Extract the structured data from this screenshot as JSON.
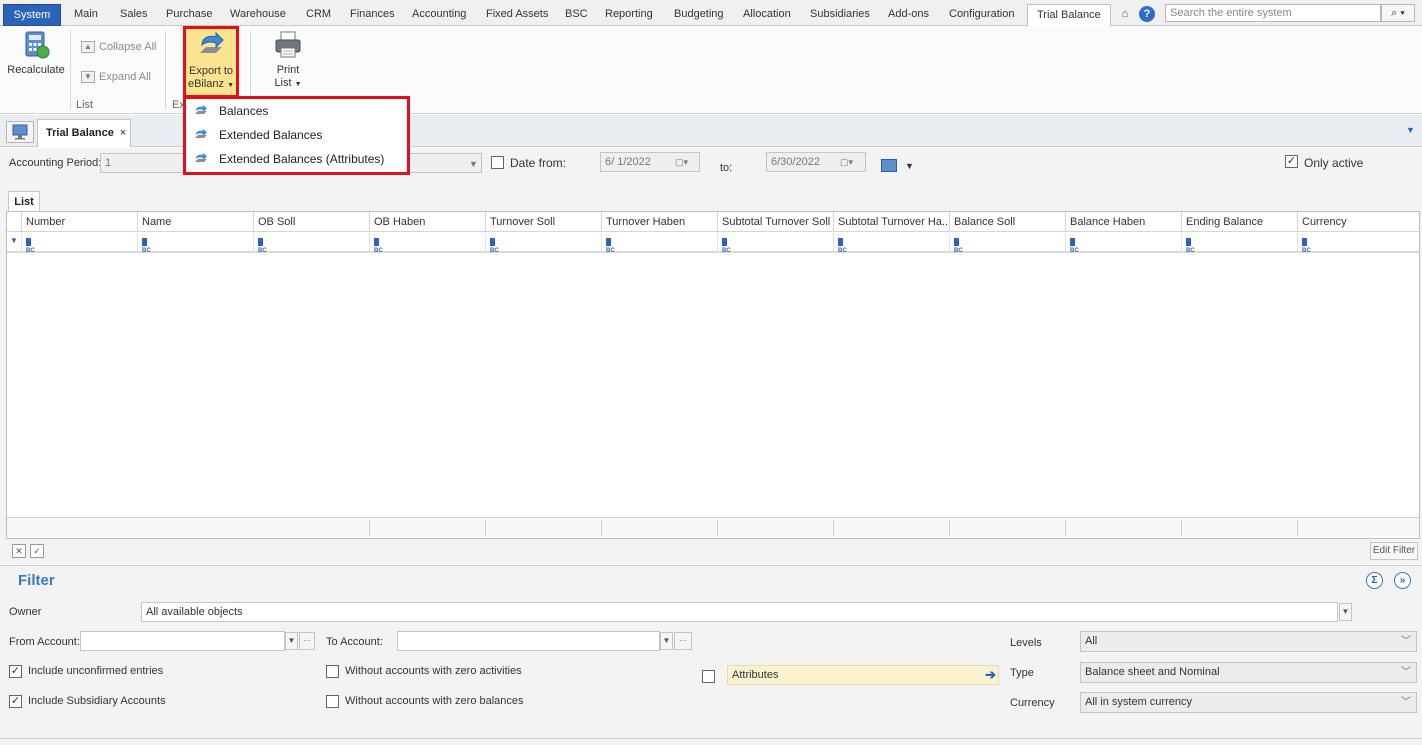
{
  "menu": {
    "tabs": [
      "System",
      "Main",
      "Sales",
      "Purchase",
      "Warehouse",
      "CRM",
      "Finances",
      "Accounting",
      "Fixed Assets",
      "BSC",
      "Reporting",
      "Budgeting",
      "Allocation",
      "Subsidiaries",
      "Add-ons",
      "Configuration",
      "Trial Balance"
    ],
    "active_tab": "Trial Balance",
    "search_placeholder": "Search the entire system"
  },
  "ribbon": {
    "recalculate": "Recalculate",
    "collapse_all": "Collapse All",
    "expand_all": "Expand All",
    "group_list": "List",
    "group_export_partial": "Ex",
    "export_line1": "Export to",
    "export_line2": "eBilanz",
    "print_line1": "Print",
    "print_line2": "List",
    "dropdown_items": [
      "Balances",
      "Extended Balances",
      "Extended Balances (Attributes)"
    ]
  },
  "doc_tab": {
    "title": "Trial Balance",
    "close": "×"
  },
  "params": {
    "accounting_period_label": "Accounting Period:",
    "accounting_period_value": "1",
    "date_from_label": "Date from:",
    "date_from_value": "6/ 1/2022",
    "to_label": "to:",
    "date_to_value": "6/30/2022",
    "only_active_label": "Only active",
    "only_active_checked": true,
    "date_from_checked": false
  },
  "list": {
    "tab": "List",
    "columns": [
      "Number",
      "Name",
      "OB Soll",
      "OB Haben",
      "Turnover Soll",
      "Turnover Haben",
      "Subtotal Turnover Soll",
      "Subtotal Turnover Ha...",
      "Balance Soll",
      "Balance Haben",
      "Ending Balance",
      "Currency"
    ],
    "filter_cell_text": "BC",
    "edit_filter": "Edit Filter"
  },
  "filter": {
    "title": "Filter",
    "owner_label": "Owner",
    "owner_value": "All available objects",
    "from_account_label": "From Account:",
    "to_account_label": "To Account:",
    "include_unconfirmed": "Include unconfirmed entries",
    "include_subsidiary": "Include Subsidiary Accounts",
    "without_zero_activities": "Without accounts with zero activities",
    "without_zero_balances": "Without accounts with zero balances",
    "attributes": "Attributes",
    "levels_label": "Levels",
    "levels_value": "All",
    "type_label": "Type",
    "type_value": "Balance sheet and Nominal",
    "currency_label": "Currency",
    "currency_value": "All in system currency"
  },
  "colors": {
    "accent": "#2b63b8",
    "highlight_border": "#e3101b",
    "export_highlight_bg": "#fbe38f"
  }
}
